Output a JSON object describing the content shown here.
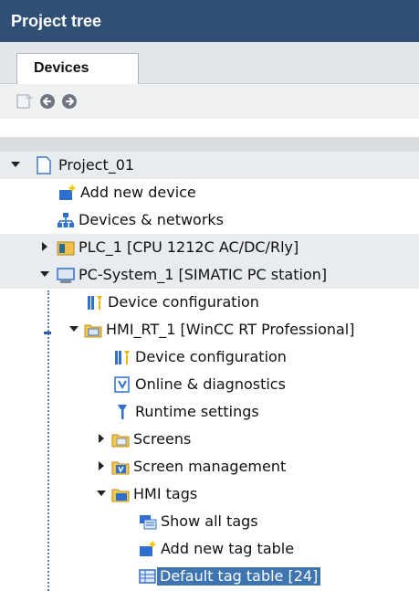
{
  "panel": {
    "title": "Project tree"
  },
  "tab": {
    "devices_label": "Devices"
  },
  "toolbar": {
    "buttons": [
      {
        "name": "new-folder-icon"
      },
      {
        "name": "back-arrow-icon"
      },
      {
        "name": "forward-arrow-icon"
      }
    ]
  },
  "tree": {
    "items": [
      {
        "label": "Project_01",
        "icon": "project-file-icon",
        "expanded": "down"
      },
      {
        "label": "Add new device",
        "icon": "add-device-icon"
      },
      {
        "label": "Devices & networks",
        "icon": "network-icon"
      },
      {
        "label": "PLC_1 [CPU 1212C AC/DC/Rly]",
        "icon": "plc-icon",
        "expanded": "right"
      },
      {
        "label": "PC-System_1 [SIMATIC PC station]",
        "icon": "pc-icon",
        "expanded": "down"
      },
      {
        "label": "Device configuration",
        "icon": "device-config-icon"
      },
      {
        "label": "HMI_RT_1 [WinCC RT Professional]",
        "icon": "hmi-folder-icon",
        "expanded": "down"
      },
      {
        "label": "Device configuration",
        "icon": "device-config-icon"
      },
      {
        "label": "Online & diagnostics",
        "icon": "diagnostics-icon"
      },
      {
        "label": "Runtime settings",
        "icon": "runtime-settings-icon"
      },
      {
        "label": "Screens",
        "icon": "screens-folder-icon",
        "expanded": "right"
      },
      {
        "label": "Screen management",
        "icon": "screen-management-icon",
        "expanded": "right"
      },
      {
        "label": "HMI tags",
        "icon": "hmi-tags-folder-icon",
        "expanded": "down"
      },
      {
        "label": "Show all tags",
        "icon": "show-tags-icon"
      },
      {
        "label": "Add new tag table",
        "icon": "add-tag-table-icon"
      },
      {
        "label": "Default tag table [24]",
        "icon": "tag-table-icon"
      }
    ]
  }
}
